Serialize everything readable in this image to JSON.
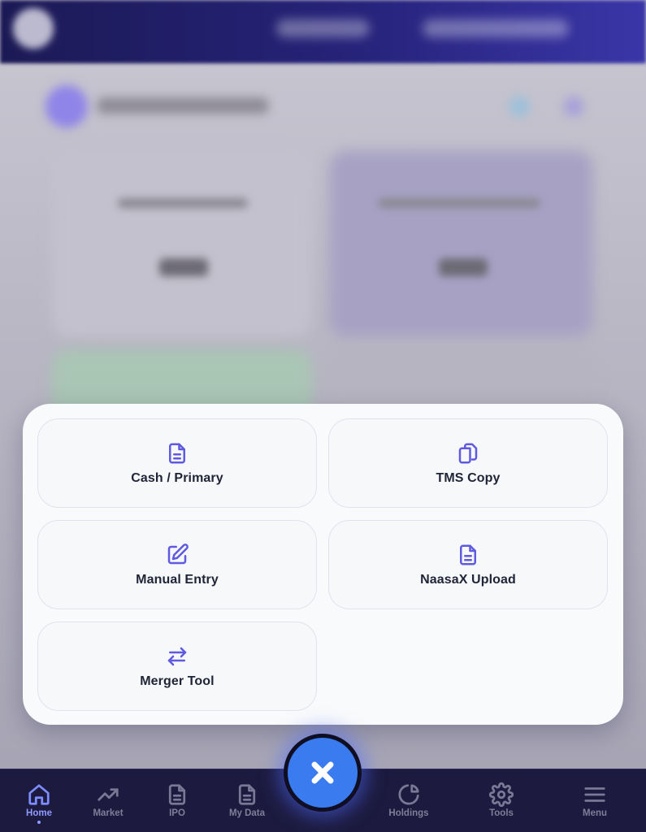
{
  "accent_color": "#5f5ae0",
  "fab_color": "#3a7cf0",
  "nav_active_color": "#8f9bff",
  "sheet": {
    "options": [
      {
        "label": "Cash / Primary",
        "icon": "document-icon"
      },
      {
        "label": "TMS Copy",
        "icon": "copy-icon"
      },
      {
        "label": "Manual Entry",
        "icon": "edit-icon"
      },
      {
        "label": "NaasaX Upload",
        "icon": "document-icon"
      },
      {
        "label": "Merger Tool",
        "icon": "swap-arrows-icon"
      }
    ]
  },
  "fab": {
    "icon": "close-icon"
  },
  "bottom_nav": {
    "active": "Home",
    "items": [
      {
        "label": "Home",
        "icon": "home-icon"
      },
      {
        "label": "Market",
        "icon": "trending-up-icon"
      },
      {
        "label": "IPO",
        "icon": "document-icon"
      },
      {
        "label": "My Data",
        "icon": "document-icon"
      },
      {
        "label": "Holdings",
        "icon": "pie-chart-icon"
      },
      {
        "label": "Tools",
        "icon": "gear-icon"
      },
      {
        "label": "Menu",
        "icon": "hamburger-menu-icon"
      }
    ]
  }
}
